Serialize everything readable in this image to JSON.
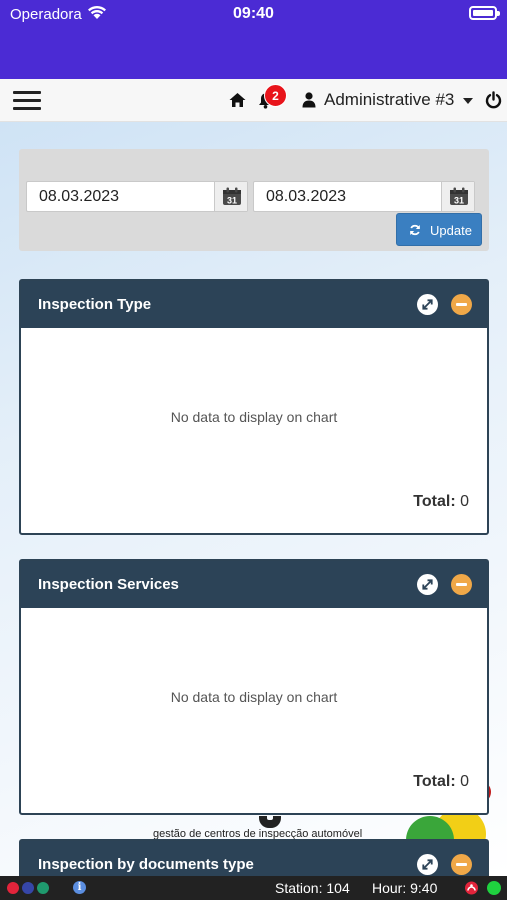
{
  "status_bar": {
    "carrier": "Operadora",
    "time": "09:40"
  },
  "navbar": {
    "notification_count": "2",
    "user_name": "Administrative #3"
  },
  "filter": {
    "date_from": "08.03.2023",
    "date_to": "08.03.2023",
    "calendar_day": "31",
    "update_label": "Update"
  },
  "panels": [
    {
      "title": "Inspection Type",
      "empty_message": "No data to display on chart",
      "total_label": "Total:",
      "total_value": "0"
    },
    {
      "title": "Inspection Services",
      "empty_message": "No data to display on chart",
      "total_label": "Total:",
      "total_value": "0"
    },
    {
      "title": "Inspection by documents type"
    }
  ],
  "background": {
    "logo_tagline": "gestão de centros de inspecção automóvel"
  },
  "bottom_bar": {
    "station": "Station: 104",
    "hour": "Hour: 9:40",
    "info_glyph": "i"
  },
  "colors": {
    "status_bar": "#4b2bd4",
    "panel_header": "#2c4357",
    "update_button": "#3a7fc1",
    "collapse_button": "#f0a848",
    "badge": "#e8141b",
    "online": "#1fd13f"
  }
}
